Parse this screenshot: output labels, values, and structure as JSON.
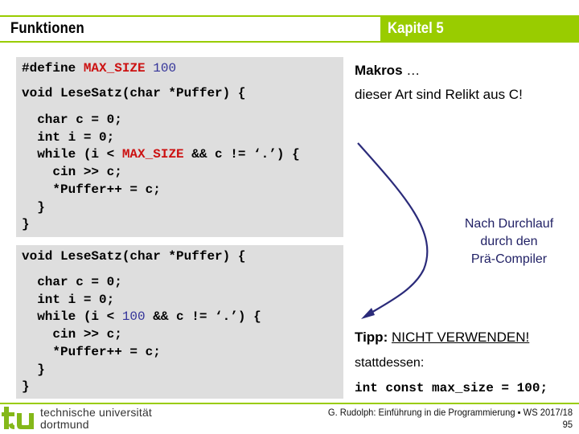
{
  "header": {
    "title": "Funktionen",
    "chapter": "Kapitel 5"
  },
  "code_block_1": {
    "line_define_prefix": "#define ",
    "line_define_macro": "MAX_SIZE",
    "line_define_space": " ",
    "line_define_value": "100",
    "line_signature": "void LeseSatz(char *Puffer) {",
    "line_char": "  char c = 0;",
    "line_int": "  int i = 0;",
    "line_while_prefix": "  while (i < ",
    "line_while_macro": "MAX_SIZE",
    "line_while_suffix": " && c != ‘.’) {",
    "line_cin": "    cin >> c;",
    "line_puffer": "    *Puffer++ = c;",
    "line_close_inner": "  }",
    "line_close_outer": "}"
  },
  "code_block_2": {
    "line_signature": "void LeseSatz(char *Puffer) {",
    "line_char": "  char c = 0;",
    "line_int": "  int i = 0;",
    "line_while_prefix": "  while (i < ",
    "line_while_value": "100",
    "line_while_suffix": " && c != ‘.’) {",
    "line_cin": "    cin >> c;",
    "line_puffer": "    *Puffer++ = c;",
    "line_close_inner": "  }",
    "line_close_outer": "}"
  },
  "right": {
    "makros_bold": "Makros",
    "makros_dots": " …",
    "relikt": "dieser Art sind Relikt aus C!",
    "annotation_lines": [
      "Nach Durchlauf",
      "durch den",
      "Prä-Compiler"
    ],
    "tipp_label": "Tipp:",
    "tipp_text": "NICHT VERWENDEN!",
    "stattdessen": "stattdessen:",
    "const_code": "int const max_size = 100;"
  },
  "colors": {
    "accent_green": "#99cc00",
    "macro_red": "#cc1111",
    "number_blue": "#333399",
    "annotation_navy": "#222266",
    "code_background": "#dedede"
  },
  "footer": {
    "university_line1": "technische universität",
    "university_line2": "dortmund",
    "credit": "G. Rudolph: Einführung in die Programmierung ▪ WS 2017/18",
    "page_number": "95"
  }
}
